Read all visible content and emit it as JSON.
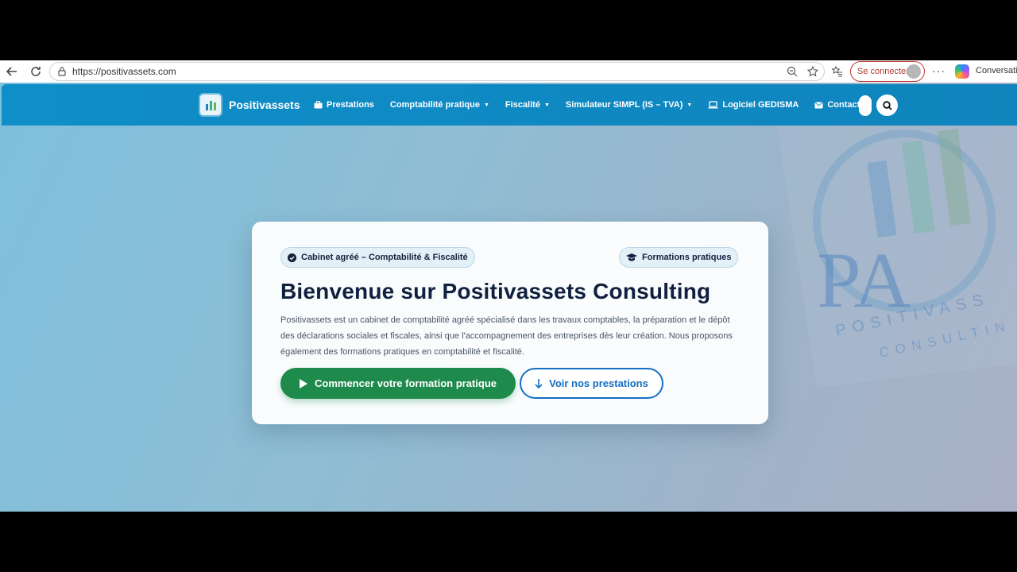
{
  "browser": {
    "url": "https://positivassets.com",
    "signin_label": "Se connecter",
    "copilot_label": "Conversatio"
  },
  "nav": {
    "brand": "Positivassets",
    "items": [
      {
        "label": "Prestations",
        "icon": "briefcase-icon",
        "dropdown": false
      },
      {
        "label": "Comptabilité pratique",
        "icon": "",
        "dropdown": true
      },
      {
        "label": "Fiscalité",
        "icon": "",
        "dropdown": true
      },
      {
        "label": "Simulateur SIMPL (IS – TVA)",
        "icon": "",
        "dropdown": true
      },
      {
        "label": "Logiciel GEDISMA",
        "icon": "laptop-icon",
        "dropdown": false
      },
      {
        "label": "Contact",
        "icon": "envelope-icon",
        "dropdown": false
      }
    ]
  },
  "hero": {
    "badge_left": "Cabinet agréé – Comptabilité & Fiscalité",
    "badge_right": "Formations pratiques",
    "title": "Bienvenue sur Positivassets Consulting",
    "text": "Positivassets est un cabinet de comptabilité agréé spécialisé dans les travaux comptables, la préparation et le dépôt des déclarations sociales et fiscales, ainsi que l'accompagnement des entreprises dès leur création. Nous proposons également des formations pratiques en comptabilité et fiscalité.",
    "primary_button": "Commencer votre formation pratique",
    "secondary_button": "Voir nos prestations"
  },
  "watermark": {
    "letters": "PA",
    "line1": "POSITIVASS",
    "line2": "CONSULTIN"
  },
  "colors": {
    "nav_bg": "#0f8ec8",
    "primary": "#1e8a4c",
    "outline": "#1470c4",
    "title": "#10203f"
  }
}
